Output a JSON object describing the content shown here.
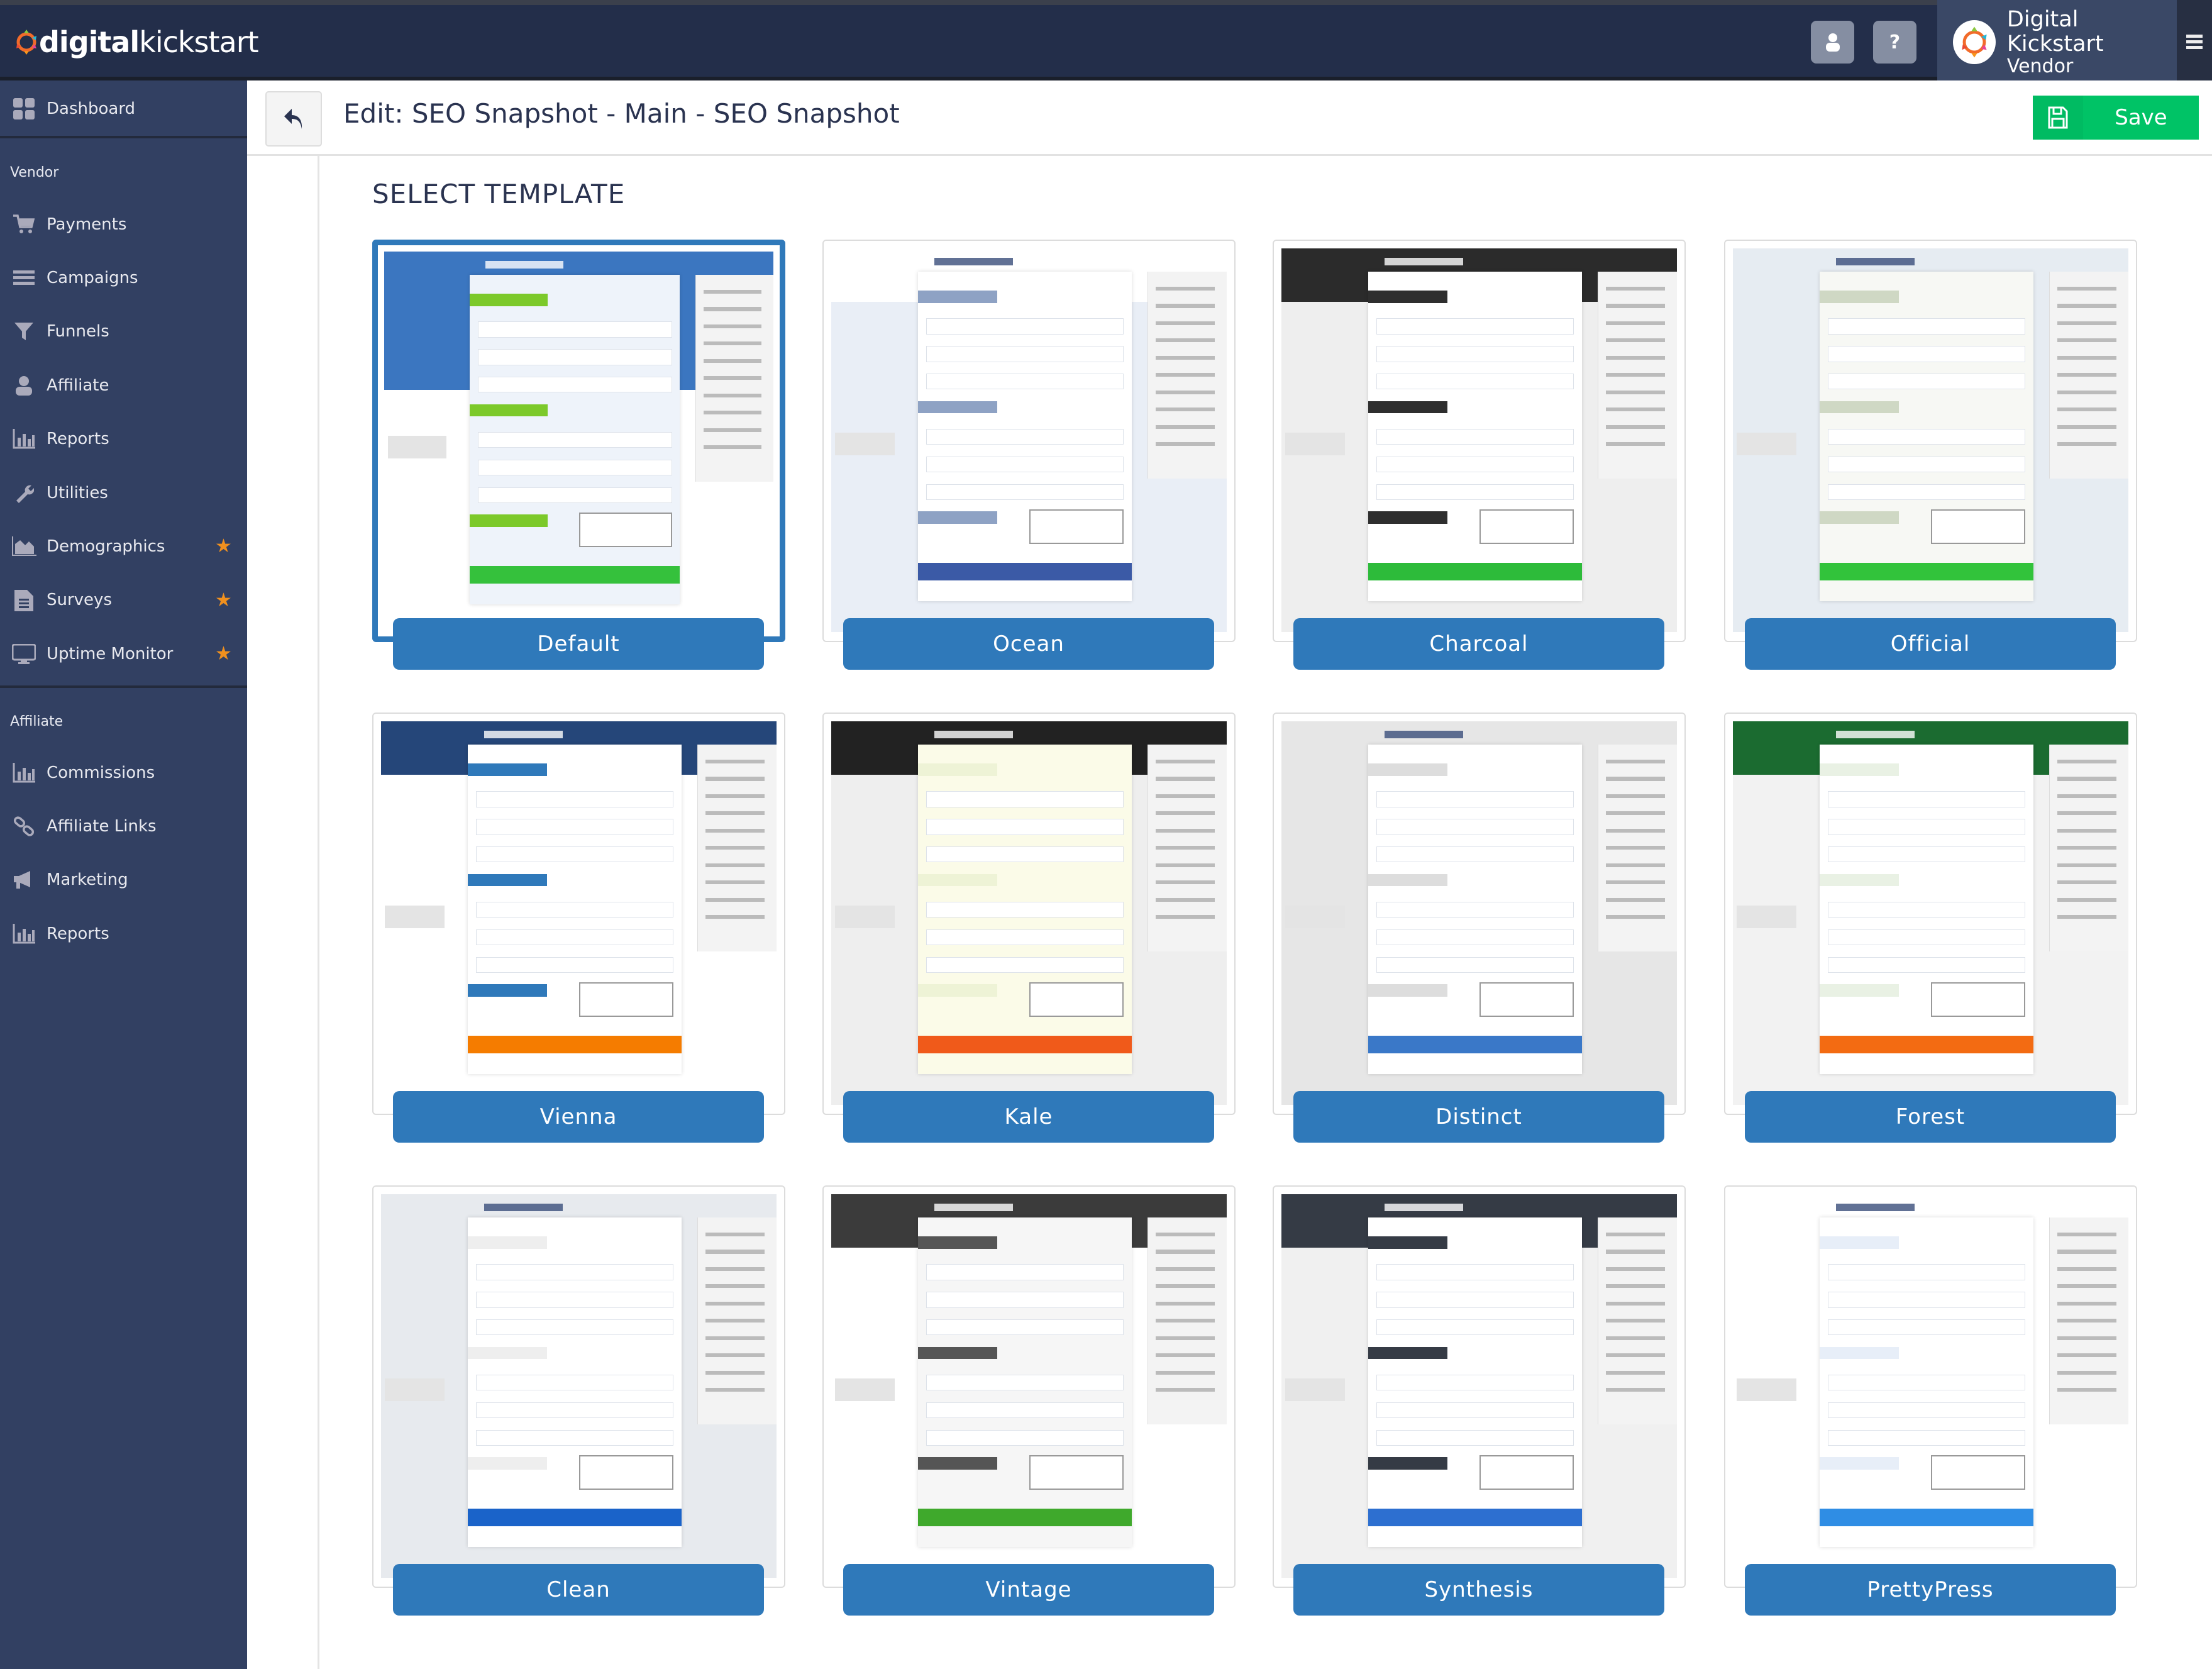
{
  "header": {
    "logo_text_bold": "digital",
    "logo_text_light": "kickstart",
    "user_button_icon": "user-icon",
    "help_button_label": "?",
    "account_name": "Digital Kickstart",
    "account_role": "Vendor"
  },
  "sidebar": {
    "dashboard": "Dashboard",
    "vendor_label": "Vendor",
    "vendor_items": [
      {
        "label": "Payments",
        "icon": "cart-icon",
        "star": false
      },
      {
        "label": "Campaigns",
        "icon": "list-icon",
        "star": false
      },
      {
        "label": "Funnels",
        "icon": "funnel-icon",
        "star": false
      },
      {
        "label": "Affiliate",
        "icon": "user-icon",
        "star": false
      },
      {
        "label": "Reports",
        "icon": "bar-chart-icon",
        "star": false
      },
      {
        "label": "Utilities",
        "icon": "wrench-icon",
        "star": false
      },
      {
        "label": "Demographics",
        "icon": "area-chart-icon",
        "star": true
      },
      {
        "label": "Surveys",
        "icon": "document-icon",
        "star": true
      },
      {
        "label": "Uptime Monitor",
        "icon": "monitor-icon",
        "star": true
      }
    ],
    "affiliate_label": "Affiliate",
    "affiliate_items": [
      {
        "label": "Commissions",
        "icon": "bar-chart-icon"
      },
      {
        "label": "Affiliate Links",
        "icon": "link-icon"
      },
      {
        "label": "Marketing",
        "icon": "megaphone-icon"
      },
      {
        "label": "Reports",
        "icon": "bar-chart-icon"
      }
    ],
    "star_color": "#f0901e"
  },
  "titlebar": {
    "title": "Edit: SEO Snapshot - Main - SEO Snapshot",
    "save_label": "Save"
  },
  "main": {
    "section_title": "SELECT TEMPLATE",
    "selected": "Default",
    "templates": [
      {
        "name": "Default",
        "theme": {
          "bg": "#ffffff",
          "header": "#3b76c0",
          "panel": "#eef3fa",
          "accent": "#7cc92a",
          "buy": "#35c13c"
        }
      },
      {
        "name": "Ocean",
        "theme": {
          "bg": "#e9eef6",
          "header": "#ffffff",
          "panel": "#ffffff",
          "accent": "#8ea2c4",
          "buy": "#3b5aa6"
        }
      },
      {
        "name": "Charcoal",
        "theme": {
          "bg": "#eeeeee",
          "header": "#2b2b2b",
          "panel": "#ffffff",
          "accent": "#2e2e2e",
          "buy": "#2dbb3a"
        }
      },
      {
        "name": "Official",
        "theme": {
          "bg": "#e6ecf2",
          "header": "#e6ecf2",
          "panel": "#f7f8f4",
          "accent": "#cfd8c4",
          "buy": "#32c33b"
        }
      },
      {
        "name": "Vienna",
        "theme": {
          "bg": "#ffffff",
          "header": "#254679",
          "panel": "#ffffff",
          "accent": "#2f79ba",
          "buy": "#f57c00"
        }
      },
      {
        "name": "Kale",
        "theme": {
          "bg": "#eeeeee",
          "header": "#222222",
          "panel": "#fbfbe8",
          "accent": "#eef3d6",
          "buy": "#f05a1a"
        }
      },
      {
        "name": "Distinct",
        "theme": {
          "bg": "#e6e6e6",
          "header": "#e6e6e6",
          "panel": "#ffffff",
          "accent": "#dddddd",
          "buy": "#3a78c8"
        }
      },
      {
        "name": "Forest",
        "theme": {
          "bg": "#f2f2f2",
          "header": "#1b6b30",
          "panel": "#ffffff",
          "accent": "#e9f1e4",
          "buy": "#f36b12"
        }
      },
      {
        "name": "Clean",
        "theme": {
          "bg": "#e7eaee",
          "header": "#e7eaee",
          "panel": "#ffffff",
          "accent": "#eeeeee",
          "buy": "#1a63c9"
        }
      },
      {
        "name": "Vintage",
        "theme": {
          "bg": "#ffffff",
          "header": "#3b3b3b",
          "panel": "#f6f6f6",
          "accent": "#555555",
          "buy": "#3fa92c"
        }
      },
      {
        "name": "Synthesis",
        "theme": {
          "bg": "#f0f0f0",
          "header": "#353b45",
          "panel": "#ffffff",
          "accent": "#353b45",
          "buy": "#2d6fd0"
        }
      },
      {
        "name": "PrettyPress",
        "theme": {
          "bg": "#ffffff",
          "header": "#ffffff",
          "panel": "#ffffff",
          "accent": "#e7eef8",
          "buy": "#2f8de4"
        }
      }
    ]
  }
}
